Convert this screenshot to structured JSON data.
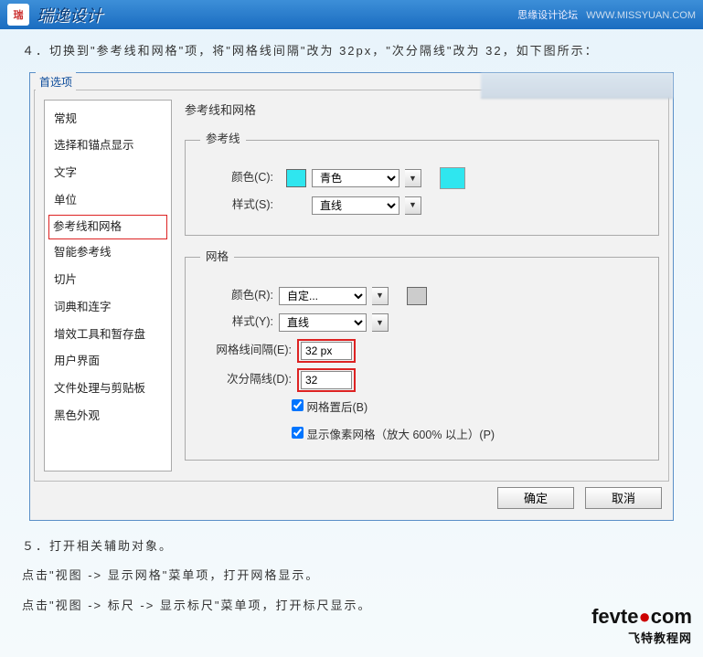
{
  "header": {
    "brand": "瑞逸设计",
    "logo_text": "瑞",
    "forum": "思缘设计论坛",
    "url": "WWW.MISSYUAN.COM"
  },
  "step4": "４．切换到\"参考线和网格\"项，将\"网格线间隔\"改为 32px，\"次分隔线\"改为 32，如下图所示：",
  "dialog": {
    "title": "首选项",
    "sidebar": {
      "items": [
        "常规",
        "选择和锚点显示",
        "文字",
        "单位",
        "参考线和网格",
        "智能参考线",
        "切片",
        "词典和连字",
        "增效工具和暂存盘",
        "用户界面",
        "文件处理与剪贴板",
        "黑色外观"
      ],
      "selected_index": 4
    },
    "panel": {
      "title": "参考线和网格",
      "guides": {
        "legend": "参考线",
        "color_label": "颜色(C):",
        "color_value": "青色",
        "style_label": "样式(S):",
        "style_value": "直线"
      },
      "grid": {
        "legend": "网格",
        "color_label": "颜色(R):",
        "color_value": "自定...",
        "style_label": "样式(Y):",
        "style_value": "直线",
        "gridline_label": "网格线间隔(E):",
        "gridline_value": "32 px",
        "subdiv_label": "次分隔线(D):",
        "subdiv_value": "32",
        "grid_back_label": "网格置后(B)",
        "grid_back_checked": true,
        "pixel_grid_label": "显示像素网格（放大 600% 以上）(P)",
        "pixel_grid_checked": true
      }
    },
    "buttons": {
      "ok": "确定",
      "cancel": "取消"
    }
  },
  "step5": "５．打开相关辅助对象。",
  "note1": "点击\"视图 -> 显示网格\"菜单项，打开网格显示。",
  "note2": "点击\"视图 -> 标尺 -> 显示标尺\"菜单项，打开标尺显示。",
  "footer": {
    "name": "fevte",
    "dot": "●",
    "com": "com",
    "cn": "飞特教程网"
  }
}
